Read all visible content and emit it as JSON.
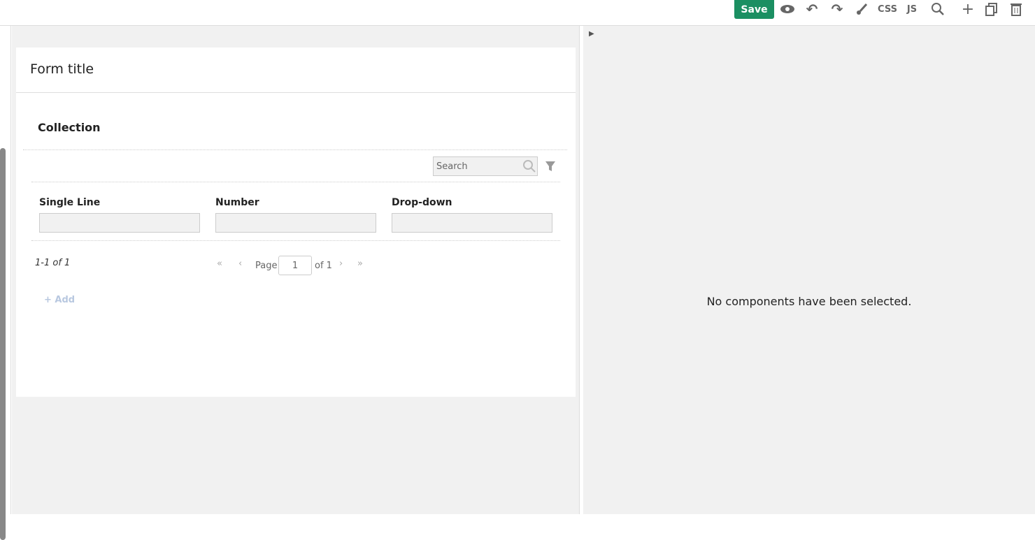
{
  "toolbar": {
    "save": "Save",
    "css": "CSS",
    "js": "JS"
  },
  "form": {
    "title": "Form title",
    "collection": "Collection",
    "search_placeholder": "Search",
    "columns": [
      "Single Line",
      "Number",
      "Drop-down"
    ],
    "pager": {
      "summary": "1-1 of 1",
      "page_label": "Page",
      "page_value": "1",
      "of_label": "of 1"
    },
    "add": "+ Add"
  },
  "properties": {
    "empty_message": "No components have been selected."
  }
}
